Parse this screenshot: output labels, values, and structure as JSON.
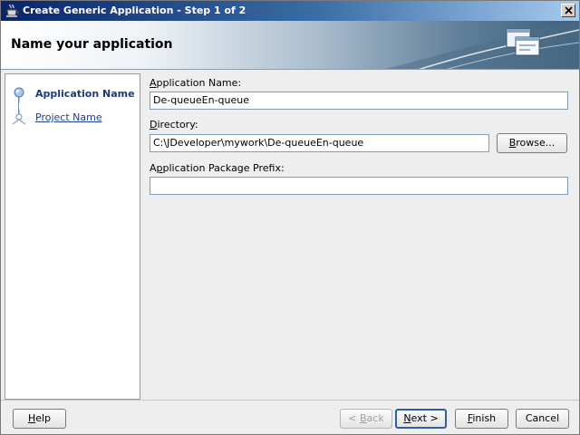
{
  "window": {
    "title": "Create Generic Application - Step 1 of 2",
    "title_icon": "coffee-cup-icon"
  },
  "header": {
    "title": "Name your application",
    "icon": "application-windows-icon"
  },
  "steps": [
    {
      "label": "Application Name",
      "state": "current"
    },
    {
      "label": "Project Name",
      "state": "link"
    }
  ],
  "form": {
    "app_name": {
      "label_mnemonic": "A",
      "label_rest": "pplication Name:",
      "value": "De-queueEn-queue"
    },
    "directory": {
      "label_mnemonic": "D",
      "label_rest": "irectory:",
      "value": "C:\\JDeveloper\\mywork\\De-queueEn-queue"
    },
    "browse": {
      "mnemonic": "B",
      "rest": "rowse..."
    },
    "package_prefix": {
      "label_pre": "A",
      "label_mnemonic": "p",
      "label_rest": "plication Package Prefix:",
      "value": ""
    }
  },
  "buttons": {
    "help": {
      "mnemonic": "H",
      "rest": "elp"
    },
    "back": {
      "pre": "< ",
      "mnemonic": "B",
      "rest": "ack",
      "enabled": false
    },
    "next": {
      "mnemonic": "N",
      "rest": "ext >"
    },
    "finish": {
      "mnemonic": "F",
      "rest": "inish"
    },
    "cancel": {
      "label": "Cancel"
    }
  },
  "colors": {
    "title_bar": "#0a246a",
    "step_active": "#1d3b78",
    "default_button_border": "#2f5ea8"
  }
}
